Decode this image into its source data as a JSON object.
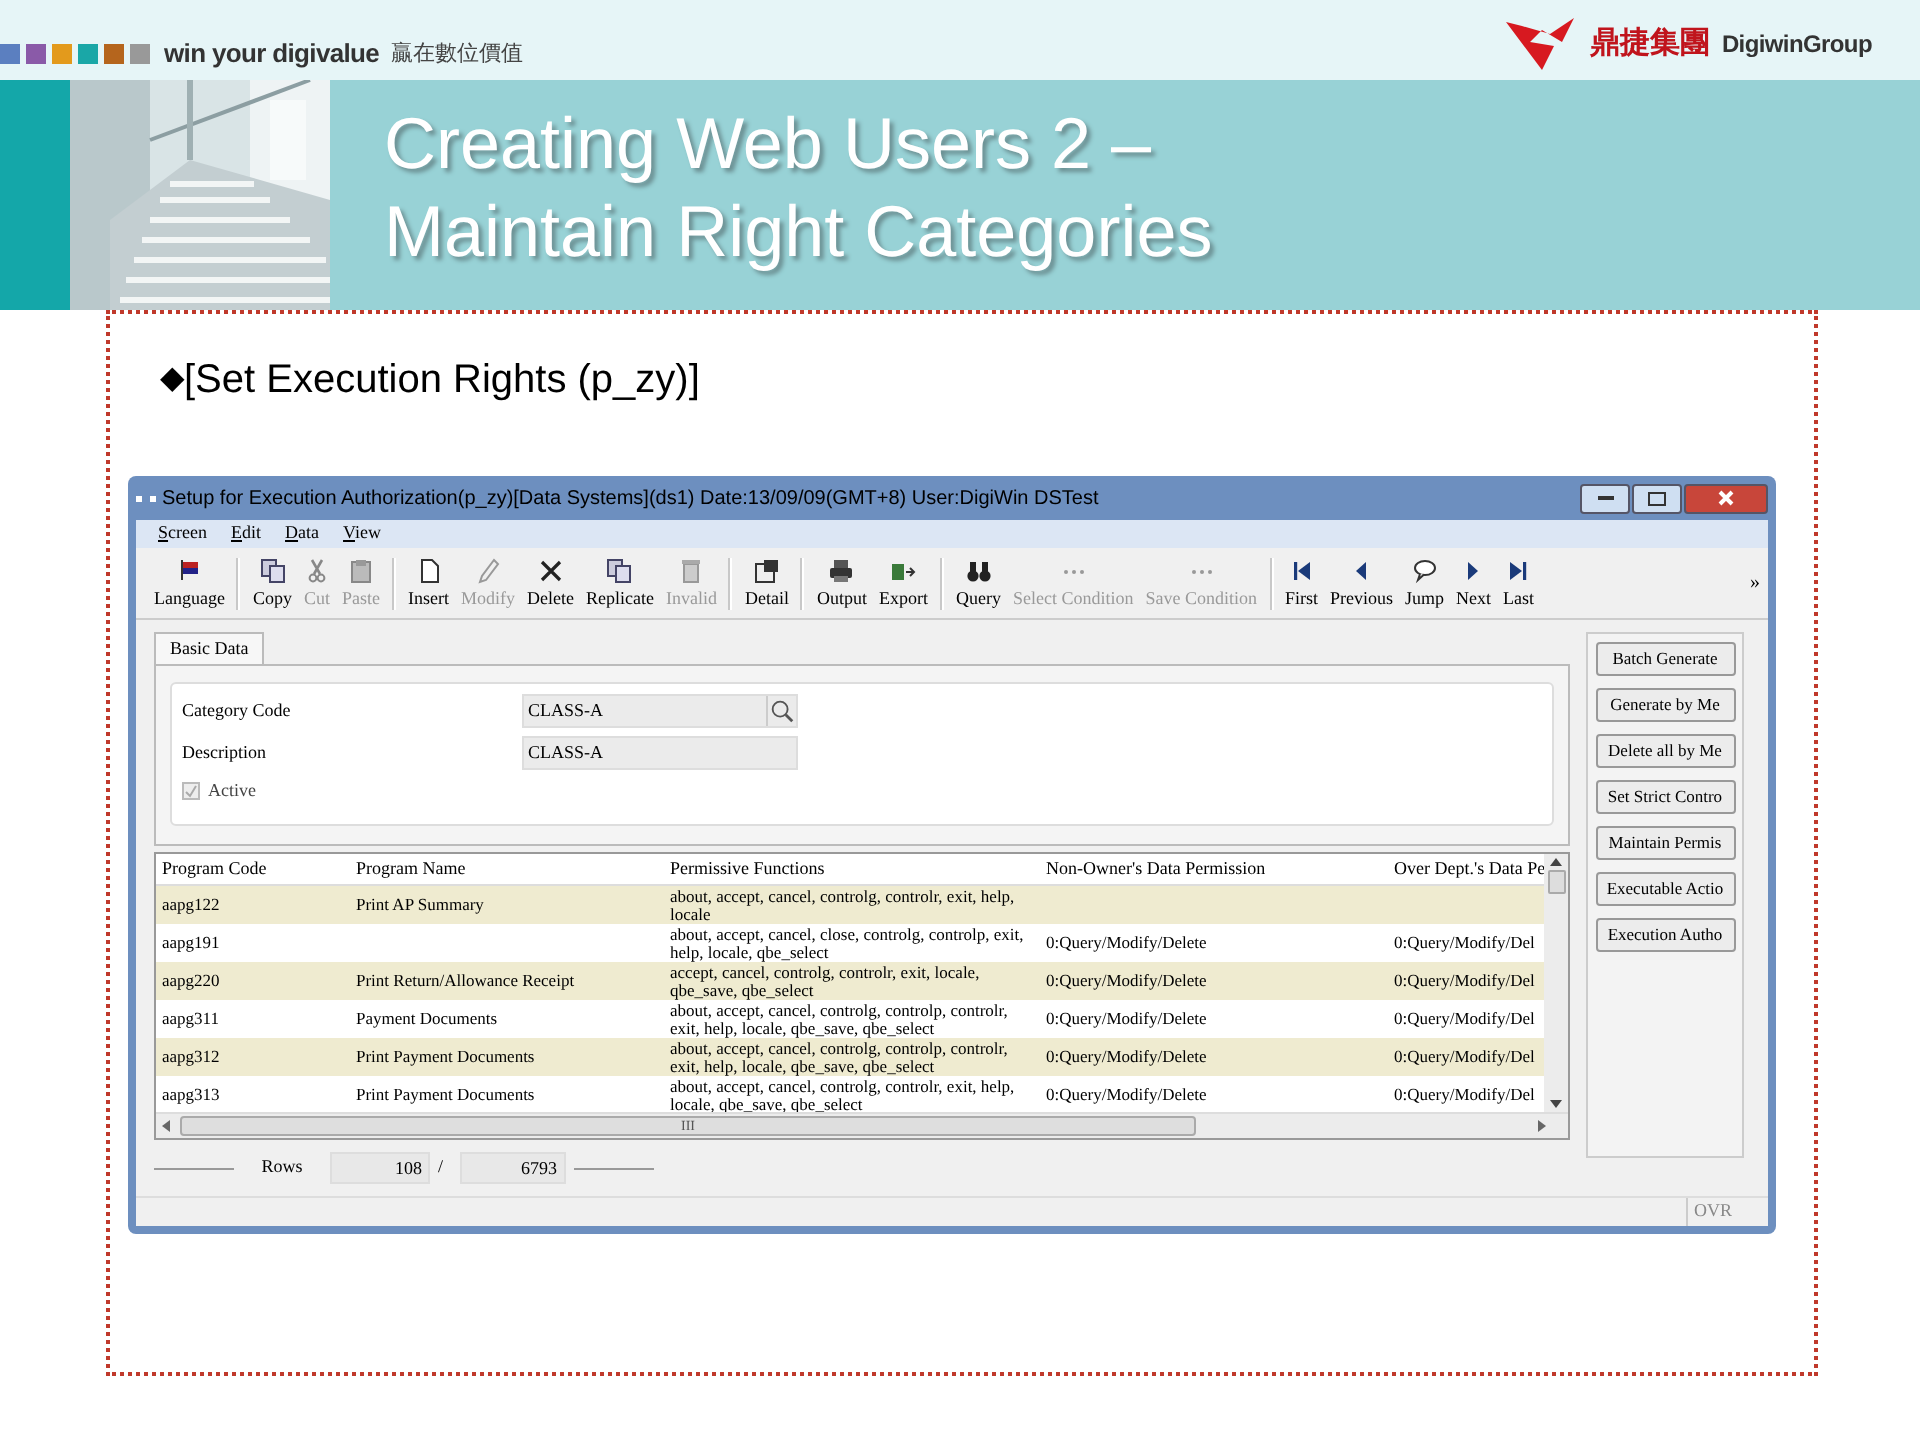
{
  "slide": {
    "tagline": "win your digivalue",
    "tagline_cn": "贏在數位價值",
    "brand_cn": "鼎捷集團",
    "brand_en": "DigiwinGroup",
    "title_lines": [
      "Creating Web Users 2 –",
      "Maintain Right Categories"
    ],
    "bullet_marker": "◆",
    "bullet": "[Set Execution Rights (p_zy)]"
  },
  "window": {
    "title": "Setup for Execution Authorization(p_zy)[Data Systems](ds1)  Date:13/09/09(GMT+8)  User:DigiWin DSTest",
    "menu": [
      "Screen",
      "Edit",
      "Data",
      "View"
    ],
    "toolbar": [
      {
        "label": "Language",
        "disabled": false,
        "separator_before": false
      },
      {
        "label": "Copy",
        "disabled": false,
        "separator_before": true
      },
      {
        "label": "Cut",
        "disabled": true,
        "separator_before": false
      },
      {
        "label": "Paste",
        "disabled": true,
        "separator_before": false
      },
      {
        "label": "Insert",
        "disabled": false,
        "separator_before": true
      },
      {
        "label": "Modify",
        "disabled": true,
        "separator_before": false
      },
      {
        "label": "Delete",
        "disabled": false,
        "separator_before": false
      },
      {
        "label": "Replicate",
        "disabled": false,
        "separator_before": false
      },
      {
        "label": "Invalid",
        "disabled": true,
        "separator_before": false
      },
      {
        "label": "Detail",
        "disabled": false,
        "separator_before": true
      },
      {
        "label": "Output",
        "disabled": false,
        "separator_before": true
      },
      {
        "label": "Export",
        "disabled": false,
        "separator_before": false
      },
      {
        "label": "Query",
        "disabled": false,
        "separator_before": true
      },
      {
        "label": "Select Condition",
        "disabled": true,
        "separator_before": false
      },
      {
        "label": "Save Condition",
        "disabled": true,
        "separator_before": false
      },
      {
        "label": "First",
        "disabled": false,
        "separator_before": true
      },
      {
        "label": "Previous",
        "disabled": false,
        "separator_before": false
      },
      {
        "label": "Jump",
        "disabled": false,
        "separator_before": false
      },
      {
        "label": "Next",
        "disabled": false,
        "separator_before": false
      },
      {
        "label": "Last",
        "disabled": false,
        "separator_before": false
      }
    ],
    "toolbar_more": "»",
    "tabs": [
      {
        "label": "Basic Data",
        "selected": true
      }
    ],
    "fields": [
      {
        "label": "Category Code",
        "value": "CLASS-A",
        "kind": "lookup"
      },
      {
        "label": "Description",
        "value": "CLASS-A",
        "kind": "text"
      }
    ],
    "active": {
      "label": "Active",
      "checked": true,
      "disabled": true
    },
    "grid": {
      "columns": [
        "Program Code",
        "Program Name",
        "Permissive Functions",
        "Non-Owner's Data Permission",
        "Over Dept.'s Data Pe"
      ],
      "rows": [
        {
          "cells": [
            "aapg122",
            "Print AP Summary",
            "about, accept, cancel, controlg, controlr, exit, help, locale",
            "",
            ""
          ]
        },
        {
          "cells": [
            "aapg191",
            "",
            "about, accept, cancel, close, controlg, controlp, exit, help, locale, qbe_select",
            "0:Query/Modify/Delete",
            "0:Query/Modify/Del"
          ]
        },
        {
          "cells": [
            "aapg220",
            "Print Return/Allowance Receipt",
            "accept, cancel, controlg, controlr, exit, locale, qbe_save, qbe_select",
            "0:Query/Modify/Delete",
            "0:Query/Modify/Del"
          ]
        },
        {
          "cells": [
            "aapg311",
            "Payment Documents",
            "about, accept, cancel, controlg, controlp, controlr, exit, help, locale, qbe_save, qbe_select",
            "0:Query/Modify/Delete",
            "0:Query/Modify/Del"
          ]
        },
        {
          "cells": [
            "aapg312",
            "Print Payment Documents",
            "about, accept, cancel, controlg, controlp, controlr, exit, help, locale, qbe_save, qbe_select",
            "0:Query/Modify/Delete",
            "0:Query/Modify/Del"
          ]
        },
        {
          "cells": [
            "aapg313",
            "Print Payment Documents",
            "about, accept, cancel, controlg, controlr, exit, help, locale, qbe_save, qbe_select",
            "0:Query/Modify/Delete",
            "0:Query/Modify/Del"
          ]
        }
      ],
      "scroll_mark": "III"
    },
    "side_buttons": [
      "Batch Generate",
      "Generate by Me",
      "Delete all by Me",
      "Set Strict Contro",
      "Maintain Permis",
      "Executable Actio",
      "Execution Autho"
    ],
    "footer": {
      "label": "Rows",
      "current": "108",
      "separator": "/",
      "total": "6793"
    },
    "status": "OVR"
  }
}
